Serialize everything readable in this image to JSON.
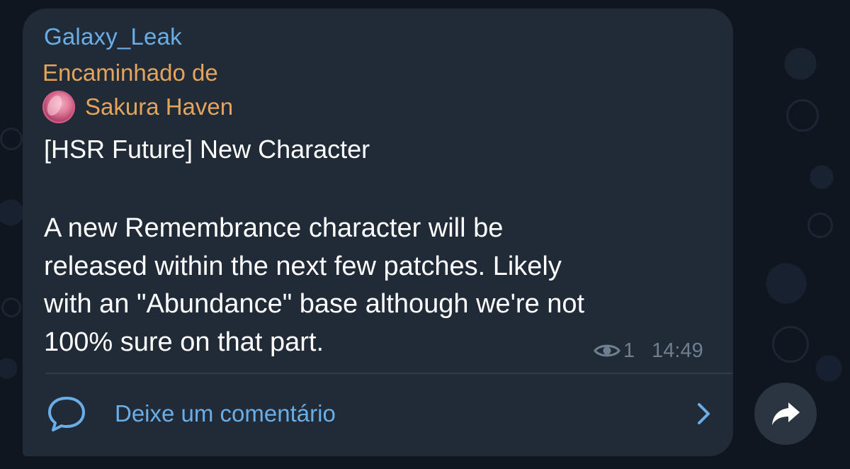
{
  "message": {
    "sender": "Galaxy_Leak",
    "forwarded_label": "Encaminhado de",
    "forwarded_from": "Sakura Haven",
    "title": "[HSR Future] New Character",
    "body_lines": [
      "A new Remembrance character will be",
      "released within the next few patches. Likely",
      "with an \"Abundance\" base although we're not",
      "100% sure on that part."
    ],
    "views": "1",
    "time": "14:49"
  },
  "comments": {
    "label": "Deixe um comentário"
  },
  "icons": {
    "views": "eye-icon",
    "comment": "comment-bubble-icon",
    "chevron": "chevron-right-icon",
    "share": "share-arrow-icon"
  },
  "colors": {
    "background": "#0f1620",
    "bubble": "#202b37",
    "sender_blue": "#6aaee8",
    "forward_orange": "#e5a45b",
    "meta_gray": "#6f7f8f"
  }
}
